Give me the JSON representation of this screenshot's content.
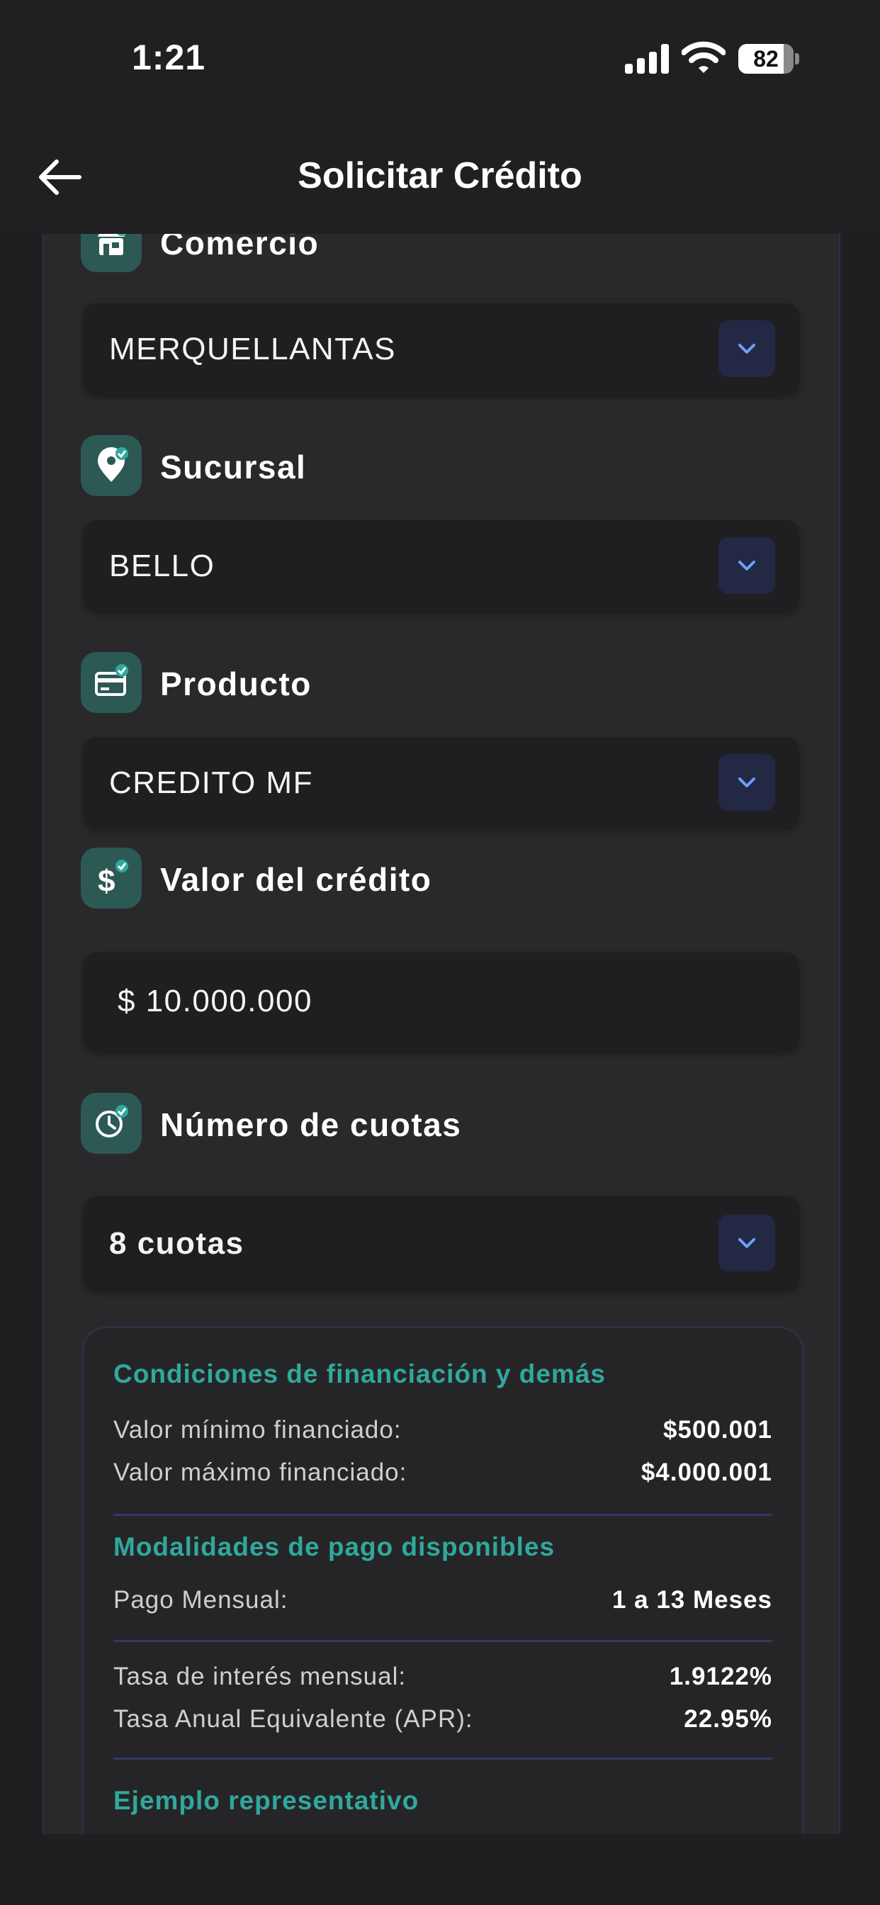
{
  "status_bar": {
    "time": "1:21",
    "battery": "82",
    "battery_level": 0.82
  },
  "header": {
    "title": "Solicitar Crédito"
  },
  "form": {
    "comercio": {
      "label": "Comercio",
      "value": "MERQUELLANTAS"
    },
    "sucursal": {
      "label": "Sucursal",
      "value": "BELLO"
    },
    "producto": {
      "label": "Producto",
      "value": "CREDITO MF"
    },
    "valor": {
      "label": "Valor del crédito",
      "value": "$ 10.000.000"
    },
    "cuotas": {
      "label": "Número de cuotas",
      "value": "8 cuotas"
    }
  },
  "conditions": {
    "financing_title": "Condiciones de financiación y demás",
    "rows": [
      {
        "label": "Valor mínimo financiado:",
        "value": "$500.001"
      },
      {
        "label": "Valor máximo financiado:",
        "value": "$4.000.001"
      }
    ],
    "payment_title": "Modalidades de pago disponibles",
    "payment_rows": [
      {
        "label": "Pago Mensual:",
        "value": "1 a 13 Meses"
      }
    ],
    "rate_rows": [
      {
        "label": "Tasa de interés mensual:",
        "value": "1.9122%"
      },
      {
        "label": "Tasa Anual Equivalente (APR):",
        "value": "22.95%"
      }
    ],
    "example_title": "Ejemplo representativo"
  },
  "colors": {
    "accent": "#30a89c",
    "icon_bg": "#2c5954",
    "dropdown_bg": "#232844",
    "divider": "#323867"
  }
}
